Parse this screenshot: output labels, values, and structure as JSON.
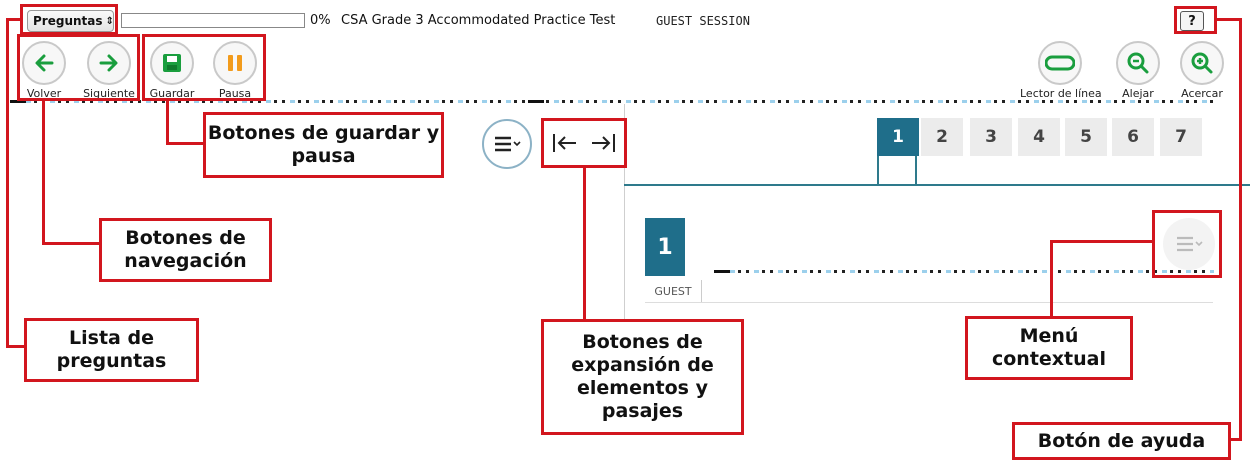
{
  "topbar": {
    "questions_select": "Preguntas",
    "progress_percent": 0,
    "progress_text": "0%",
    "test_title": "CSA Grade 3 Accommodated Practice Test",
    "session": "GUEST SESSION",
    "help_label": "?"
  },
  "tools_left": [
    {
      "label": "Volver",
      "icon": "arrow-left-icon",
      "color": "#1a9e3e"
    },
    {
      "label": "Siguiente",
      "icon": "arrow-right-icon",
      "color": "#1a9e3e"
    },
    {
      "label": "Guardar",
      "icon": "save-icon",
      "color": "#1a9e3e"
    },
    {
      "label": "Pausa",
      "icon": "pause-icon",
      "color": "#f29b1b"
    }
  ],
  "tools_right": [
    {
      "label": "Lector de línea",
      "icon": "line-reader-icon"
    },
    {
      "label": "Alejar",
      "icon": "zoom-out-icon"
    },
    {
      "label": "Acercar",
      "icon": "zoom-in-icon"
    }
  ],
  "tabs": [
    "1",
    "2",
    "3",
    "4",
    "5",
    "6",
    "7"
  ],
  "active_tab": "1",
  "question": {
    "number": "1",
    "guest_label": "GUEST"
  },
  "annotations": {
    "save_pause": "Botones de guardar y pausa",
    "navigation": "Botones de navegación",
    "question_list": "Lista de preguntas",
    "expansion": "Botones de expansión de elementos y pasajes",
    "context_menu": "Menú contextual",
    "help": "Botón de ayuda"
  },
  "colors": {
    "annotation": "#d2161e",
    "accent_teal": "#1f6e8a",
    "green": "#1a9e3e",
    "orange": "#f29b1b",
    "progress": "#3a7ad0"
  }
}
